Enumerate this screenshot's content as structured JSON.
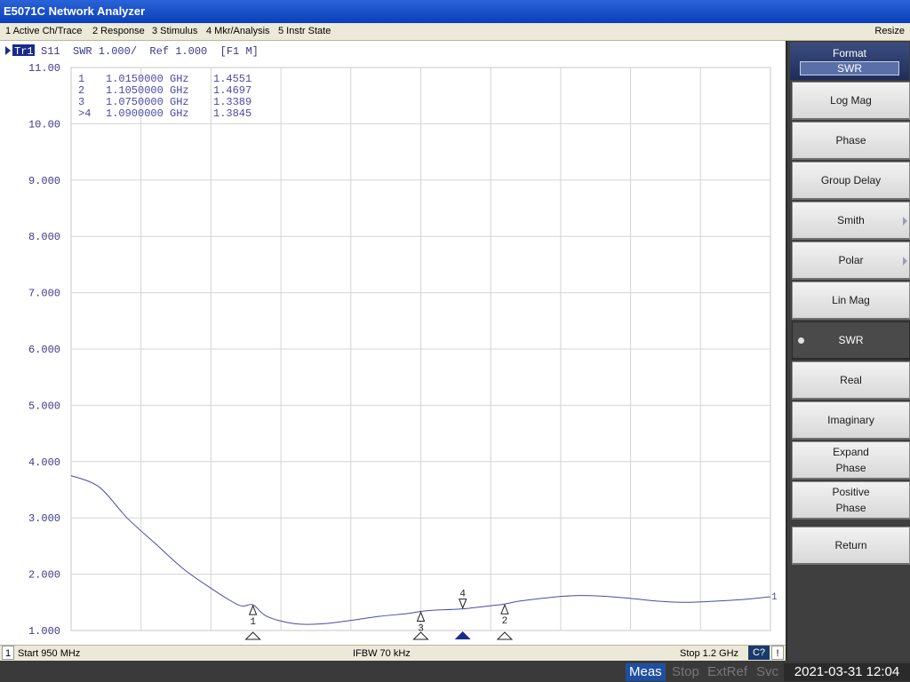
{
  "window": {
    "title": "E5071C Network Analyzer"
  },
  "menubar": {
    "items": [
      "1 Active Ch/Trace",
      "2 Response",
      "3 Stimulus",
      "4 Mkr/Analysis",
      "5 Instr State"
    ],
    "resize": "Resize"
  },
  "trace": {
    "tag": "Tr1",
    "info": "S11  SWR 1.000/  Ref 1.000  [F1 M]",
    "end_label": "1",
    "color": "#4a4aa8"
  },
  "markers": [
    {
      "label": "1",
      "freq": "1.0150000 GHz",
      "value": "1.4551",
      "freq_ghz": 1.015,
      "swr": 1.4551
    },
    {
      "label": "2",
      "freq": "1.1050000 GHz",
      "value": "1.4697",
      "freq_ghz": 1.105,
      "swr": 1.4697
    },
    {
      "label": "3",
      "freq": "1.0750000 GHz",
      "value": "1.3389",
      "freq_ghz": 1.075,
      "swr": 1.3389
    },
    {
      "label": "4",
      "freq": "1.0900000 GHz",
      "value": "1.3845",
      "freq_ghz": 1.09,
      "swr": 1.3845,
      "active": true
    }
  ],
  "marker_table": [
    {
      "prefix": " 1",
      "freq": "1.0150000 GHz",
      "value": "1.4551"
    },
    {
      "prefix": " 2",
      "freq": "1.1050000 GHz",
      "value": "1.4697"
    },
    {
      "prefix": " 3",
      "freq": "1.0750000 GHz",
      "value": "1.3389"
    },
    {
      "prefix": ">4",
      "freq": "1.0900000 GHz",
      "value": "1.3845"
    }
  ],
  "chart_data": {
    "type": "line",
    "title": "",
    "xlabel": "",
    "ylabel": "",
    "xlim": [
      0.95,
      1.2
    ],
    "ylim": [
      1.0,
      11.0
    ],
    "ytick_labels": [
      "11.00",
      "10.00",
      "9.000",
      "8.000",
      "7.000",
      "6.000",
      "5.000",
      "4.000",
      "3.000",
      "2.000",
      "1.000"
    ],
    "grid": true,
    "series": [
      {
        "x": [
          0.95,
          0.96,
          0.97,
          0.98,
          0.99,
          1.0,
          1.01,
          1.015,
          1.02,
          1.03,
          1.04,
          1.05,
          1.06,
          1.07,
          1.075,
          1.08,
          1.09,
          1.1,
          1.105,
          1.11,
          1.12,
          1.13,
          1.14,
          1.15,
          1.16,
          1.17,
          1.18,
          1.19,
          1.2
        ],
        "y": [
          3.75,
          3.55,
          3.0,
          2.55,
          2.1,
          1.75,
          1.45,
          1.4551,
          1.25,
          1.12,
          1.12,
          1.18,
          1.25,
          1.3,
          1.3389,
          1.36,
          1.3845,
          1.44,
          1.4697,
          1.52,
          1.58,
          1.62,
          1.61,
          1.57,
          1.52,
          1.5,
          1.52,
          1.55,
          1.6
        ]
      }
    ]
  },
  "status": {
    "channel": "1",
    "start": "Start 950 MHz",
    "ifbw": "IFBW 70 kHz",
    "stop": "Stop 1.2 GHz",
    "cal": "C?",
    "warn": "!"
  },
  "bottom": {
    "meas": "Meas",
    "stop": "Stop",
    "extref": "ExtRef",
    "svc": "Svc",
    "clock": "2021-03-31 12:04"
  },
  "softkeys": {
    "title": "Format",
    "current": "SWR",
    "items": [
      {
        "label": "Log Mag"
      },
      {
        "label": "Phase"
      },
      {
        "label": "Group Delay"
      },
      {
        "label": "Smith",
        "submenu": true
      },
      {
        "label": "Polar",
        "submenu": true
      },
      {
        "label": "Lin Mag"
      },
      {
        "label": "SWR",
        "active": true
      },
      {
        "label": "Real"
      },
      {
        "label": "Imaginary"
      },
      {
        "label": "Expand\nPhase"
      },
      {
        "label": "Positive\nPhase"
      },
      {
        "label": "Return"
      }
    ]
  }
}
